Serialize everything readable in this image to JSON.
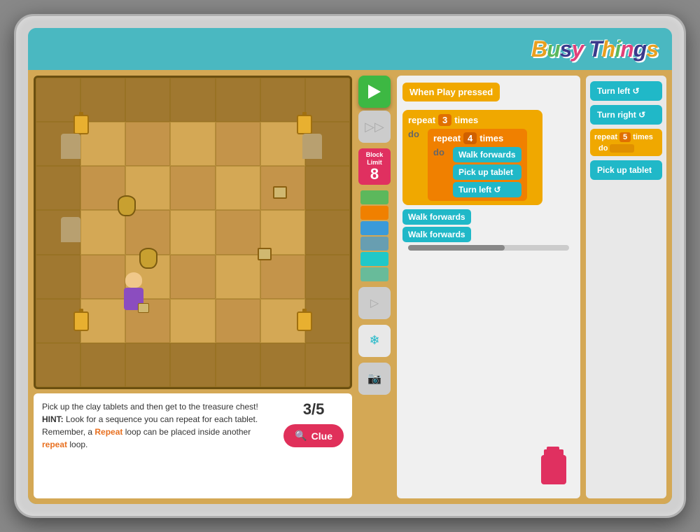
{
  "app": {
    "title": "Busy Things",
    "logo_letters": [
      "B",
      "u",
      "s",
      "y",
      " ",
      "T",
      "h",
      "i",
      "n",
      "g",
      "s"
    ]
  },
  "game": {
    "score": "3/5",
    "info_text_1": "Pick up the clay tablets and then get to the treasure chest!",
    "hint_label": "HINT:",
    "hint_text": " Look for a sequence you can repeat for each tablet. Remember, a ",
    "repeat_word_1": "Repeat",
    "hint_text_2": " loop can be placed inside another ",
    "repeat_word_2": "repeat",
    "hint_text_3": " loop."
  },
  "controls": {
    "play_label": "Play",
    "step_label": "Step",
    "block_limit_label": "Block Limit",
    "block_limit_number": "8",
    "clue_label": "Clue"
  },
  "code_blocks": {
    "when_play_pressed": "When Play pressed",
    "repeat_3": "repeat",
    "num_3": "3",
    "times_1": "times",
    "do_1": "do",
    "repeat_4": "repeat",
    "num_4": "4",
    "times_2": "times",
    "do_2": "do",
    "walk_forwards": "Walk forwards",
    "pick_up_tablet": "Pick up tablet",
    "turn_left": "Turn left ↺",
    "walk_forwards_2": "Walk forwards",
    "walk_forwards_3": "Walk forwards"
  },
  "palette": {
    "turn_left": "Turn left ↺",
    "turn_right": "Turn right ↺",
    "repeat_5_label": "repeat",
    "repeat_5_num": "5",
    "repeat_5_times": "times",
    "do_palette": "do",
    "pick_up_tablet": "Pick up tablet"
  },
  "colors": {
    "yellow_block": "#f0a800",
    "teal_block": "#20b8c8",
    "orange_block": "#f08000",
    "green_block": "#40b840",
    "pink_block": "#e03060",
    "play_green": "#3db843"
  }
}
